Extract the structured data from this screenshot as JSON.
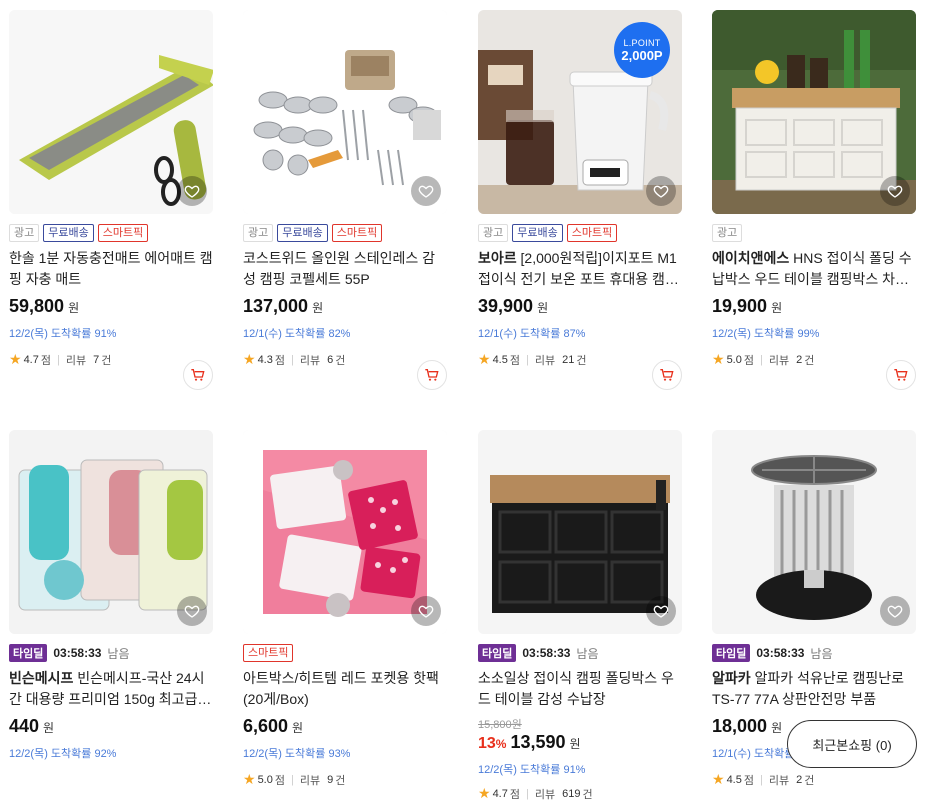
{
  "accent": {
    "discount": "#e8301c",
    "delivery": "#4a7bd8",
    "timedeal": "#6e2f95",
    "free_shipping": "#3a4a9c",
    "smart": "#e0352b"
  },
  "products": [
    {
      "badges": [
        "광고",
        "무료배송",
        "스마트픽"
      ],
      "title": "한솔 1분 자동충전매트 에어매트 캠핑 자충 매트",
      "price": "59,800",
      "won": "원",
      "delivery": "12/2(목) 도착확률 91%",
      "rating": "4.7",
      "rating_unit": "점",
      "review_label": "리뷰",
      "review_count": "7",
      "review_unit": "건",
      "wish_icon": "heart-icon",
      "cart_icon": "cart-icon"
    },
    {
      "badges": [
        "광고",
        "무료배송",
        "스마트픽"
      ],
      "title": "코스트위드 올인원 스테인레스 감성 캠핑 코펠세트 55P",
      "price": "137,000",
      "won": "원",
      "delivery": "12/1(수) 도착확률 82%",
      "rating": "4.3",
      "rating_unit": "점",
      "review_label": "리뷰",
      "review_count": "6",
      "review_unit": "건"
    },
    {
      "badges": [
        "광고",
        "무료배송",
        "스마트픽"
      ],
      "title_brand": "보아르",
      "title": "[2,000원적립]이지포트 M1 접이식 전기 보온 포트 휴대용 캠…",
      "lpoint_title": "L.POINT",
      "lpoint_value": "2,000P",
      "price": "39,900",
      "won": "원",
      "delivery": "12/1(수) 도착확률 87%",
      "rating": "4.5",
      "rating_unit": "점",
      "review_label": "리뷰",
      "review_count": "21",
      "review_unit": "건"
    },
    {
      "badges": [
        "광고"
      ],
      "title_brand": "에이치앤에스",
      "title": "HNS 접이식 폴딩 수납박스 우드 테이블 캠핑박스 차…",
      "price": "19,900",
      "won": "원",
      "delivery": "12/2(목) 도착확률 99%",
      "rating": "5.0",
      "rating_unit": "점",
      "review_label": "리뷰",
      "review_count": "2",
      "review_unit": "건"
    },
    {
      "timedeal": "타임딜",
      "time": "03:58:33",
      "time_left": "남음",
      "title_brand": "빈슨메시프",
      "title": "빈슨메시프-국산 24시간 대용량 프리미엄 150g 최고급…",
      "price": "440",
      "won": "원",
      "delivery": "12/2(목) 도착확률 92%"
    },
    {
      "badges": [
        "스마트픽"
      ],
      "title": "아트박스/히트템 레드 포켓용 핫팩(20게/Box)",
      "price": "6,600",
      "won": "원",
      "delivery": "12/2(목) 도착확률 93%",
      "rating": "5.0",
      "rating_unit": "점",
      "review_label": "리뷰",
      "review_count": "9",
      "review_unit": "건"
    },
    {
      "timedeal": "타임딜",
      "time": "03:58:33",
      "time_left": "남음",
      "title": "소소일상 접이식 캠핑 폴딩박스 우드 테이블 감성 수납장",
      "orig_price": "15,800원",
      "discount": "13",
      "discount_unit": "%",
      "price": "13,590",
      "won": "원",
      "delivery": "12/2(목) 도착확률 91%",
      "rating": "4.7",
      "rating_unit": "점",
      "review_label": "리뷰",
      "review_count": "619",
      "review_unit": "건"
    },
    {
      "timedeal": "타임딜",
      "time": "03:58:33",
      "time_left": "남음",
      "title_brand": "알파카",
      "title": "알파카 석유난로 캠핑난로 TS-77 77A 상판안전망 부품",
      "price": "18,000",
      "won": "원",
      "delivery": "12/1(수) 도착확률",
      "rating": "4.5",
      "rating_unit": "점",
      "review_label": "리뷰",
      "review_count": "2",
      "review_unit": "건"
    }
  ],
  "recent": {
    "label": "최근본쇼핑 (0)"
  }
}
